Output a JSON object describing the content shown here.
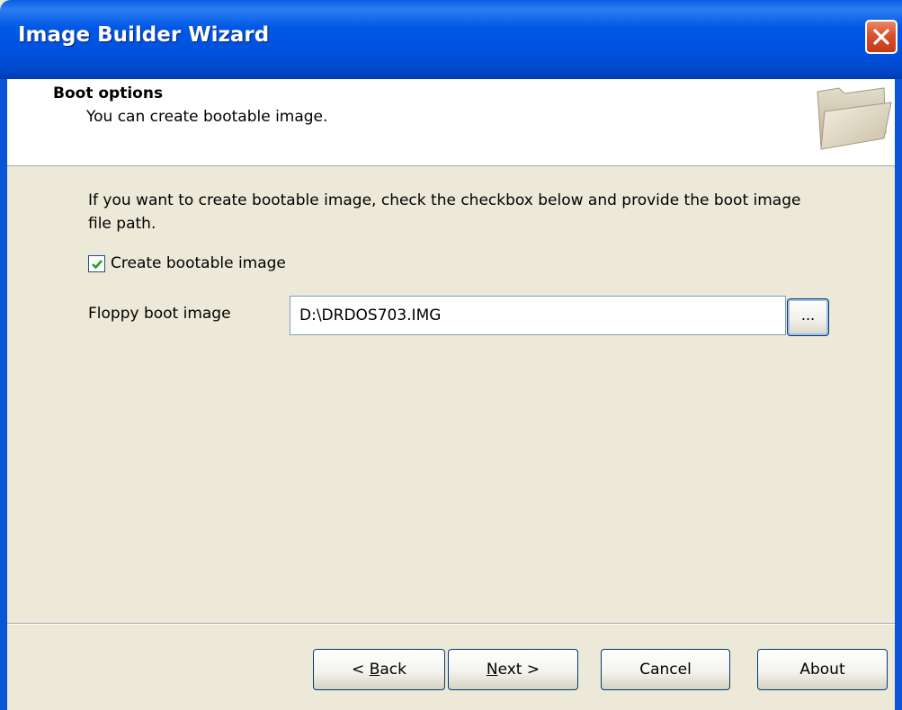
{
  "window": {
    "title": "Image Builder Wizard"
  },
  "header": {
    "title": "Boot options",
    "subtitle": "You can create bootable image.",
    "icon": "folder-icon"
  },
  "content": {
    "instructions": "If you want to create bootable image, check the checkbox below and provide the boot image file path.",
    "create_bootable": {
      "label": "Create bootable image",
      "checked": true
    },
    "floppy": {
      "label": "Floppy boot image",
      "value": "D:\\DRDOS703.IMG",
      "browse_label": "..."
    }
  },
  "buttons": {
    "back": {
      "prefix": "< ",
      "accel": "B",
      "rest": "ack"
    },
    "next": {
      "accel": "N",
      "rest": "ext >"
    },
    "cancel": "Cancel",
    "about": "About"
  }
}
